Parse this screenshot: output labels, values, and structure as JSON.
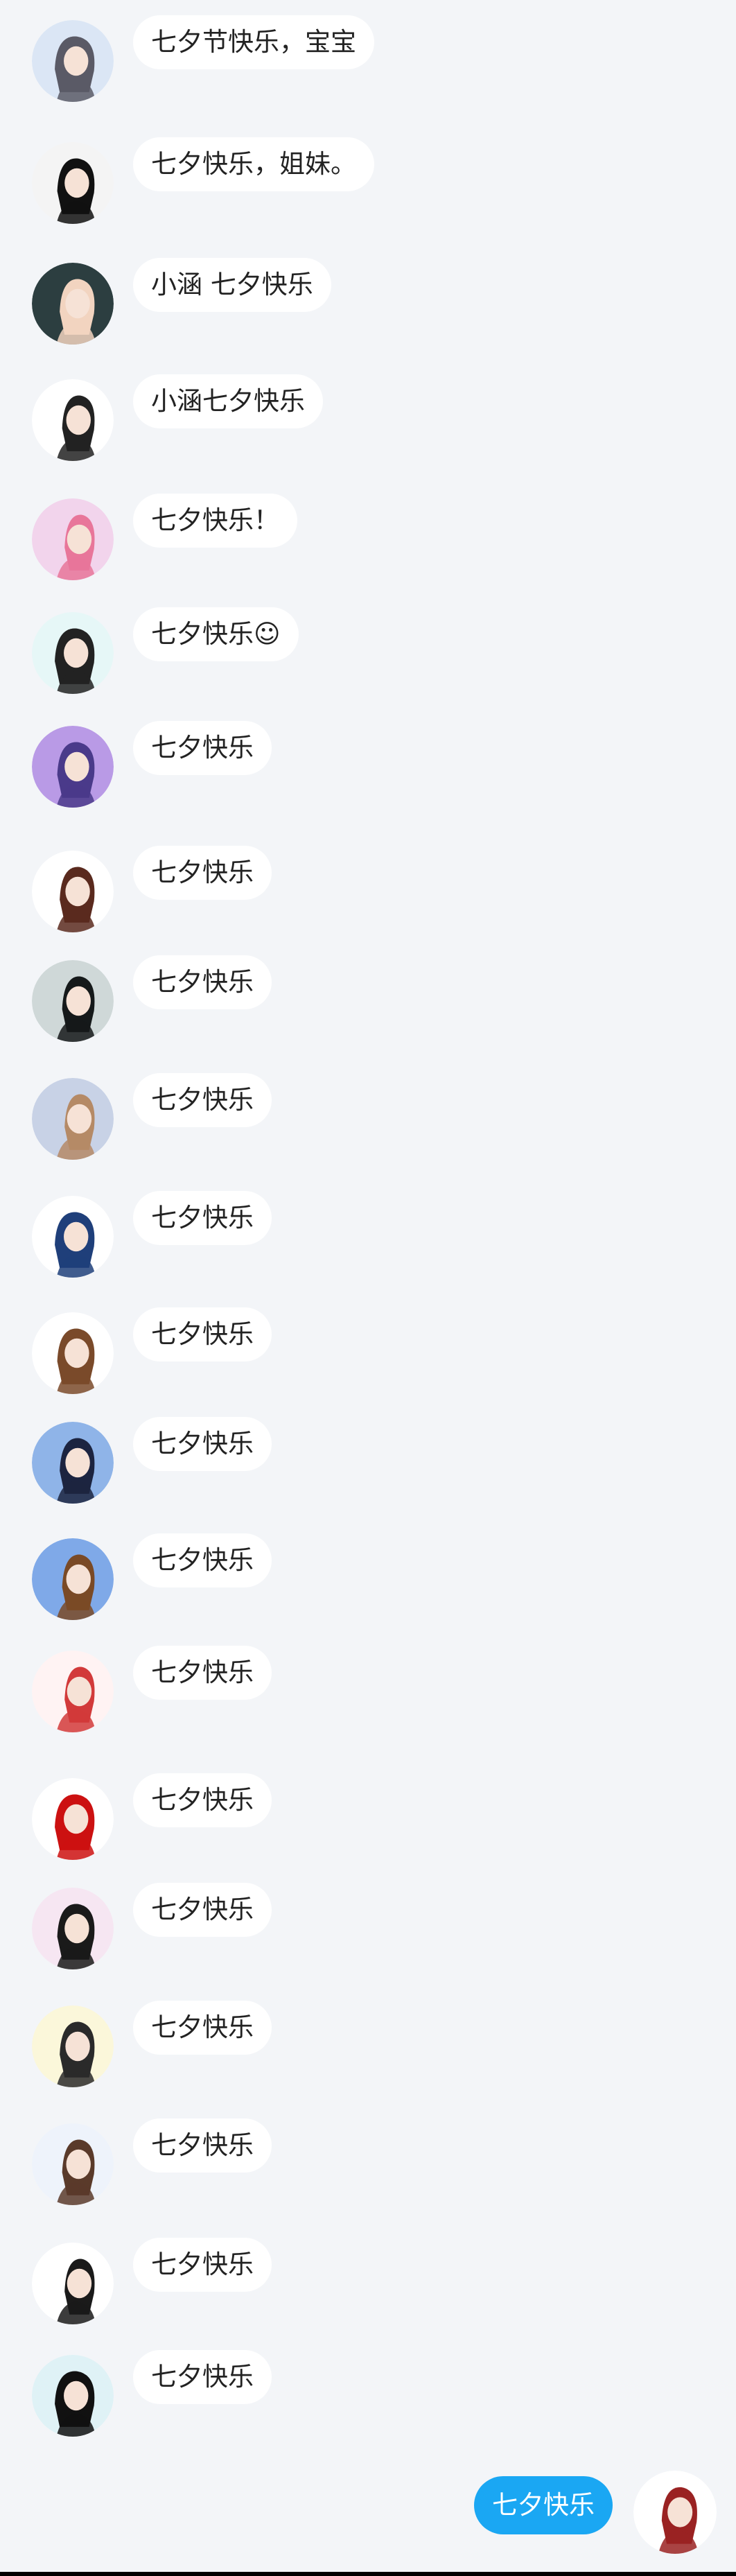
{
  "messages": [
    {
      "text": "七夕节快乐，宝宝",
      "avatar_icon": "avatar-white-hair-girl-icon",
      "avatar_bg": "#dbe6f5",
      "avatar_fg": "#5a5a66"
    },
    {
      "text": "七夕快乐，姐妹。",
      "avatar_icon": "avatar-black-silhouette-icon",
      "avatar_bg": "#f4f4f4",
      "avatar_fg": "#111111"
    },
    {
      "text": "小涵 七夕快乐",
      "avatar_icon": "avatar-dark-hair-boy-icon",
      "avatar_bg": "#2c3e40",
      "avatar_fg": "#f2d4c0"
    },
    {
      "text": "小涵七夕快乐",
      "avatar_icon": "avatar-side-profile-icon",
      "avatar_bg": "#ffffff",
      "avatar_fg": "#222222"
    },
    {
      "text": "七夕快乐！",
      "avatar_icon": "avatar-pink-hair-girl-icon",
      "avatar_bg": "#f2d4ec",
      "avatar_fg": "#e8769a"
    },
    {
      "text": "七夕快乐☺",
      "avatar_icon": "avatar-standing-figure-icon",
      "avatar_bg": "#e6f7f7",
      "avatar_fg": "#222222"
    },
    {
      "text": "七夕快乐",
      "avatar_icon": "avatar-purple-hair-boy-icon",
      "avatar_bg": "#b99ae6",
      "avatar_fg": "#4a3a8a"
    },
    {
      "text": "七夕快乐",
      "avatar_icon": "avatar-brown-curly-hair-icon",
      "avatar_bg": "#ffffff",
      "avatar_fg": "#5a2a1e"
    },
    {
      "text": "七夕快乐",
      "avatar_icon": "avatar-black-hair-man-icon",
      "avatar_bg": "#cfd8d8",
      "avatar_fg": "#15191a"
    },
    {
      "text": "七夕快乐",
      "avatar_icon": "avatar-crowned-girl-icon",
      "avatar_bg": "#c8d2e6",
      "avatar_fg": "#b58a66"
    },
    {
      "text": "七夕快乐",
      "avatar_icon": "avatar-blue-hair-girl-icon",
      "avatar_bg": "#ffffff",
      "avatar_fg": "#1f3f7a"
    },
    {
      "text": "七夕快乐",
      "avatar_icon": "avatar-brown-bob-girl-icon",
      "avatar_bg": "#ffffff",
      "avatar_fg": "#7a4a2a"
    },
    {
      "text": "七夕快乐",
      "avatar_icon": "avatar-navy-hair-boy-icon",
      "avatar_bg": "#8fb4e8",
      "avatar_fg": "#1c2440"
    },
    {
      "text": "七夕快乐",
      "avatar_icon": "avatar-brown-hair-boy-icon",
      "avatar_bg": "#7fa9e8",
      "avatar_fg": "#7a4a26"
    },
    {
      "text": "七夕快乐",
      "avatar_icon": "avatar-red-dress-figure-icon",
      "avatar_bg": "#fff3f3",
      "avatar_fg": "#d23a3a"
    },
    {
      "text": "七夕快乐",
      "avatar_icon": "avatar-red-cloak-icon",
      "avatar_bg": "#ffffff",
      "avatar_fg": "#cc1111"
    },
    {
      "text": "七夕快乐",
      "avatar_icon": "avatar-dark-dress-girl-icon",
      "avatar_bg": "#f6e6f2",
      "avatar_fg": "#1a1a1a"
    },
    {
      "text": "七夕快乐",
      "avatar_icon": "avatar-soldier-figure-icon",
      "avatar_bg": "#fbf7da",
      "avatar_fg": "#2a2a2a"
    },
    {
      "text": "七夕快乐",
      "avatar_icon": "avatar-couple-icon",
      "avatar_bg": "#eef3fb",
      "avatar_fg": "#5a3a2a"
    },
    {
      "text": "七夕快乐",
      "avatar_icon": "avatar-small-figure-icon",
      "avatar_bg": "#ffffff",
      "avatar_fg": "#1a1a1a"
    },
    {
      "text": "七夕快乐",
      "avatar_icon": "avatar-gothic-girl-icon",
      "avatar_bg": "#dff2f6",
      "avatar_fg": "#111111"
    }
  ],
  "self_message": {
    "text": "七夕快乐",
    "avatar_icon": "avatar-red-hair-girl-icon",
    "avatar_bg": "#ffffff",
    "avatar_fg": "#9a2222"
  },
  "colors": {
    "background": "#f3f5f8",
    "incoming_bubble": "#ffffff",
    "outgoing_bubble": "#1aa7f3",
    "outgoing_text": "#ffffff"
  }
}
